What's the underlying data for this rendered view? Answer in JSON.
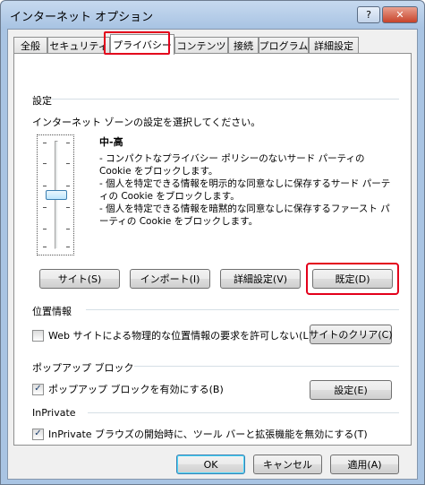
{
  "window": {
    "title": "インターネット オプション",
    "help_label": "?",
    "close_label": "✕"
  },
  "tabs": [
    {
      "label": "全般"
    },
    {
      "label": "セキュリティ"
    },
    {
      "label": "プライバシー"
    },
    {
      "label": "コンテンツ"
    },
    {
      "label": "接続"
    },
    {
      "label": "プログラム"
    },
    {
      "label": "詳細設定"
    }
  ],
  "settings": {
    "group_label": "設定",
    "instruction": "インターネット ゾーンの設定を選択してください。",
    "level_title": "中-高",
    "level_fraction": 0.5,
    "description": [
      "- コンパクトなプライバシー ポリシーのないサード パーティの Cookie をブロックします。",
      "- 個人を特定できる情報を明示的な同意なしに保存するサード パーティの Cookie をブロックします。",
      "- 個人を特定できる情報を暗黙的な同意なしに保存するファースト パーティの Cookie をブロックします。"
    ],
    "buttons": {
      "sites": "サイト(S)",
      "import": "インポート(I)",
      "advanced": "詳細設定(V)",
      "default": "既定(D)"
    }
  },
  "location": {
    "group_label": "位置情報",
    "checkbox_label": "Web サイトによる物理的な位置情報の要求を許可しない(L)",
    "checked": false,
    "clear_sites_button": "サイトのクリア(C)"
  },
  "popup": {
    "group_label": "ポップアップ ブロック",
    "checkbox_label": "ポップアップ ブロックを有効にする(B)",
    "checked": true,
    "settings_button": "設定(E)"
  },
  "inprivate": {
    "group_label": "InPrivate",
    "checkbox_label": "InPrivate ブラウズの開始時に、ツール バーと拡張機能を無効にする(T)",
    "checked": true
  },
  "footer": {
    "ok": "OK",
    "cancel": "キャンセル",
    "apply": "適用(A)"
  },
  "colors": {
    "highlight": "#e3001b",
    "window_frame": "#a9c4e3"
  }
}
